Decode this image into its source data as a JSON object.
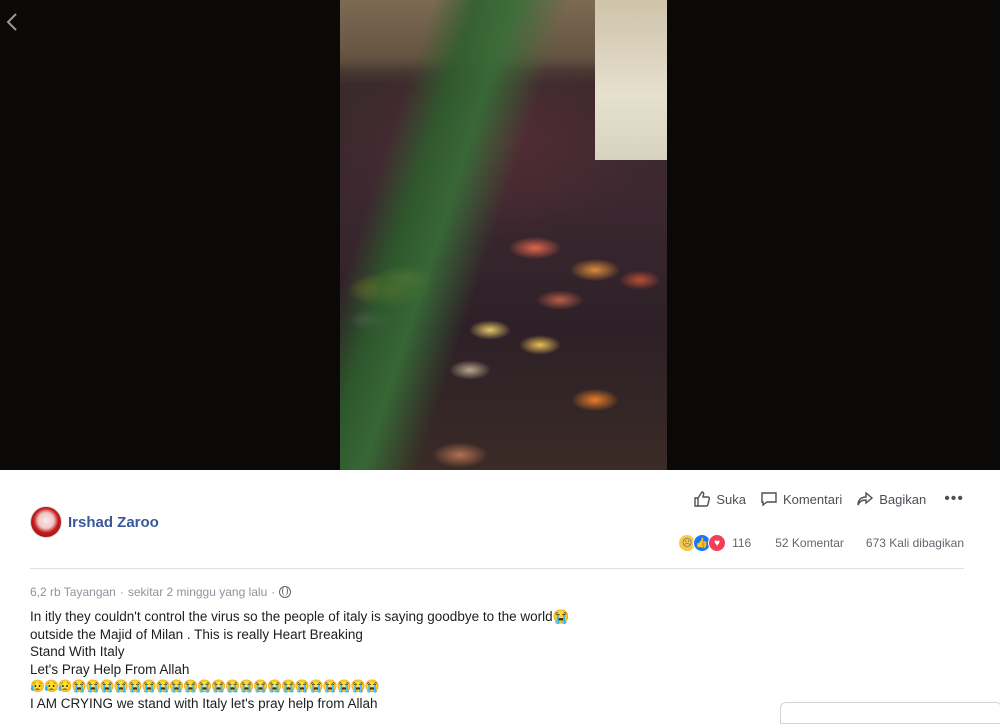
{
  "nav": {
    "back_icon": "chevron-left-icon"
  },
  "video": {
    "description_icon": "video-frame"
  },
  "post": {
    "author": {
      "name": "Irshad Zaroo"
    },
    "actions": {
      "like": "Suka",
      "comment": "Komentari",
      "share": "Bagikan",
      "more": "•••"
    },
    "stats": {
      "reaction_count": "116",
      "comments": "52 Komentar",
      "shares": "673 Kali dibagikan",
      "reaction_icons": [
        "sad-reaction-icon",
        "like-reaction-icon",
        "love-reaction-icon"
      ]
    },
    "meta": {
      "views": "6,2 rb Tayangan",
      "separator": "·",
      "time": "sekitar 2 minggu yang lalu",
      "separator2": "·"
    },
    "text": {
      "line1": "In itly they couldn't control the virus so the people of italy is saying goodbye to the world😭",
      "line2": "outside the Majid of Milan . This is really Heart Breaking",
      "line3": "Stand With Italy",
      "line4": "Let's Pray Help From Allah",
      "line5": "😥😥😥😭😭😭😭😭😭😭😭😭😭😭😭😭😭😭😭😭😭😭😭😭😭",
      "line6": "I AM CRYING we stand with Italy let's pray help from Allah"
    }
  },
  "colors": {
    "author_link": "#385898",
    "text": "#1c1e21",
    "meta": "#8d949e",
    "video_bg": "#0b0908"
  }
}
